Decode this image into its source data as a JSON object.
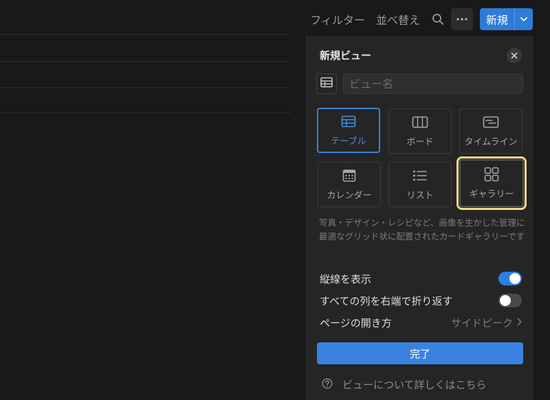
{
  "toolbar": {
    "filter_label": "フィルター",
    "sort_label": "並べ替え",
    "search_icon": "search-icon",
    "more_icon": "more-horizontal-icon",
    "new_label": "新規",
    "new_dropdown_icon": "chevron-down-icon"
  },
  "panel": {
    "title": "新規ビュー",
    "name_placeholder": "ビュー名",
    "layouts": [
      {
        "label": "テーブル",
        "icon": "table-icon",
        "selected": true
      },
      {
        "label": "ボード",
        "icon": "board-icon"
      },
      {
        "label": "タイムライン",
        "icon": "timeline-icon"
      },
      {
        "label": "カレンダー",
        "icon": "calendar-icon"
      },
      {
        "label": "リスト",
        "icon": "list-icon"
      },
      {
        "label": "ギャラリー",
        "icon": "gallery-icon",
        "highlighted": true
      }
    ],
    "description": "写真・デザイン・レシピなど、画像を生かした管理に最適なグリッド状に配置されたカードギャラリーです",
    "options": {
      "vertical_lines_label": "縦線を表示",
      "vertical_lines_on": true,
      "wrap_label": "すべての列を右端で折り返す",
      "wrap_on": false,
      "open_page_label": "ページの開き方",
      "open_page_value": "サイドピーク"
    },
    "done_label": "完了",
    "help_label": "ビューについて詳しくはこちら"
  },
  "colors": {
    "background": "#191919",
    "panel": "#252525",
    "accent": "#2e7bd8",
    "highlight": "#f0d88c"
  }
}
